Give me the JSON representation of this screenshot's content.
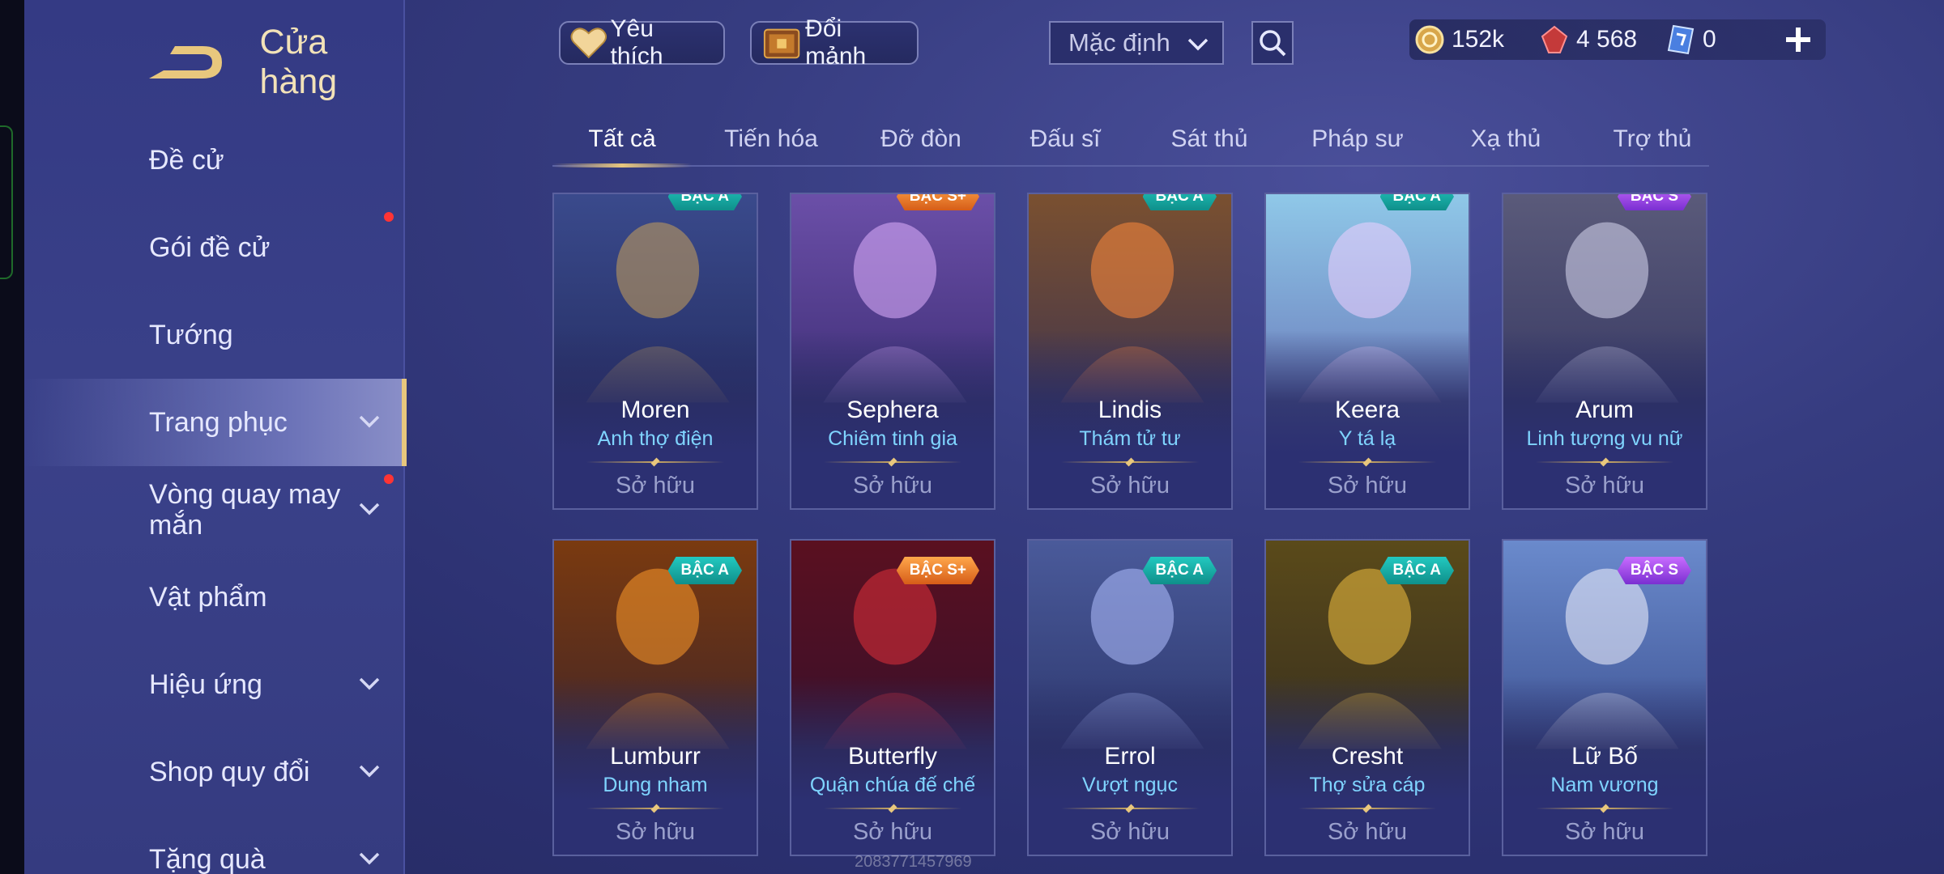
{
  "colors": {
    "accent_gold": "#e8c77d",
    "skin_name": "#7fd4ff",
    "notification_dot": "#ff3434"
  },
  "header": {
    "title": "Cửa hàng",
    "back_icon": "back-arrow-icon"
  },
  "sidebar": {
    "items": [
      {
        "label": "Đề cử",
        "expandable": false,
        "dot": false,
        "active": false
      },
      {
        "label": "Gói đề cử",
        "expandable": false,
        "dot": true,
        "active": false
      },
      {
        "label": "Tướng",
        "expandable": false,
        "dot": false,
        "active": false
      },
      {
        "label": "Trang phục",
        "expandable": true,
        "dot": false,
        "active": true
      },
      {
        "label": "Vòng quay may mắn",
        "expandable": true,
        "dot": true,
        "active": false
      },
      {
        "label": "Vật phẩm",
        "expandable": false,
        "dot": false,
        "active": false
      },
      {
        "label": "Hiệu ứng",
        "expandable": true,
        "dot": false,
        "active": false
      },
      {
        "label": "Shop quy đổi",
        "expandable": true,
        "dot": false,
        "active": false
      },
      {
        "label": "Tặng quà",
        "expandable": true,
        "dot": false,
        "active": false
      }
    ]
  },
  "topbar": {
    "favorite_label": "Yêu thích",
    "exchange_label": "Đổi mảnh",
    "sort": {
      "selected": "Mặc định"
    },
    "currencies": [
      {
        "icon": "gold-coin-icon",
        "value": "152k"
      },
      {
        "icon": "red-gem-icon",
        "value": "4 568"
      },
      {
        "icon": "voucher-icon",
        "value": "0"
      }
    ]
  },
  "tabs": [
    {
      "label": "Tất cả",
      "active": true
    },
    {
      "label": "Tiến hóa",
      "active": false
    },
    {
      "label": "Đỡ đòn",
      "active": false
    },
    {
      "label": "Đấu sĩ",
      "active": false
    },
    {
      "label": "Sát thủ",
      "active": false
    },
    {
      "label": "Pháp sư",
      "active": false
    },
    {
      "label": "Xạ thủ",
      "active": false
    },
    {
      "label": "Trợ thủ",
      "active": false
    }
  ],
  "skins": [
    {
      "hero": "Moren",
      "skin": "Anh thợ điện",
      "status": "Sở hữu",
      "tier": "BẬC A",
      "tier_class": "a"
    },
    {
      "hero": "Sephera",
      "skin": "Chiêm tinh gia",
      "status": "Sở hữu",
      "tier": "BẬC S+",
      "tier_class": "splus"
    },
    {
      "hero": "Lindis",
      "skin": "Thám tử tư",
      "status": "Sở hữu",
      "tier": "BẬC A",
      "tier_class": "a"
    },
    {
      "hero": "Keera",
      "skin": "Y tá lạ",
      "status": "Sở hữu",
      "tier": "BẬC A",
      "tier_class": "a"
    },
    {
      "hero": "Arum",
      "skin": "Linh tượng vu nữ",
      "status": "Sở hữu",
      "tier": "BẬC S",
      "tier_class": "s"
    },
    {
      "hero": "Lumburr",
      "skin": "Dung nham",
      "status": "Sở hữu",
      "tier": "BẬC A",
      "tier_class": "a"
    },
    {
      "hero": "Butterfly",
      "skin": "Quận chúa đế chế",
      "status": "Sở hữu",
      "tier": "BẬC S+",
      "tier_class": "splus"
    },
    {
      "hero": "Errol",
      "skin": "Vượt ngục",
      "status": "Sở hữu",
      "tier": "BẬC A",
      "tier_class": "a"
    },
    {
      "hero": "Cresht",
      "skin": "Thợ sửa cáp",
      "status": "Sở hữu",
      "tier": "BẬC A",
      "tier_class": "a"
    },
    {
      "hero": "Lữ Bố",
      "skin": "Nam vương",
      "status": "Sở hữu",
      "tier": "BẬC S",
      "tier_class": "s"
    }
  ],
  "watermark": "2083771457969"
}
